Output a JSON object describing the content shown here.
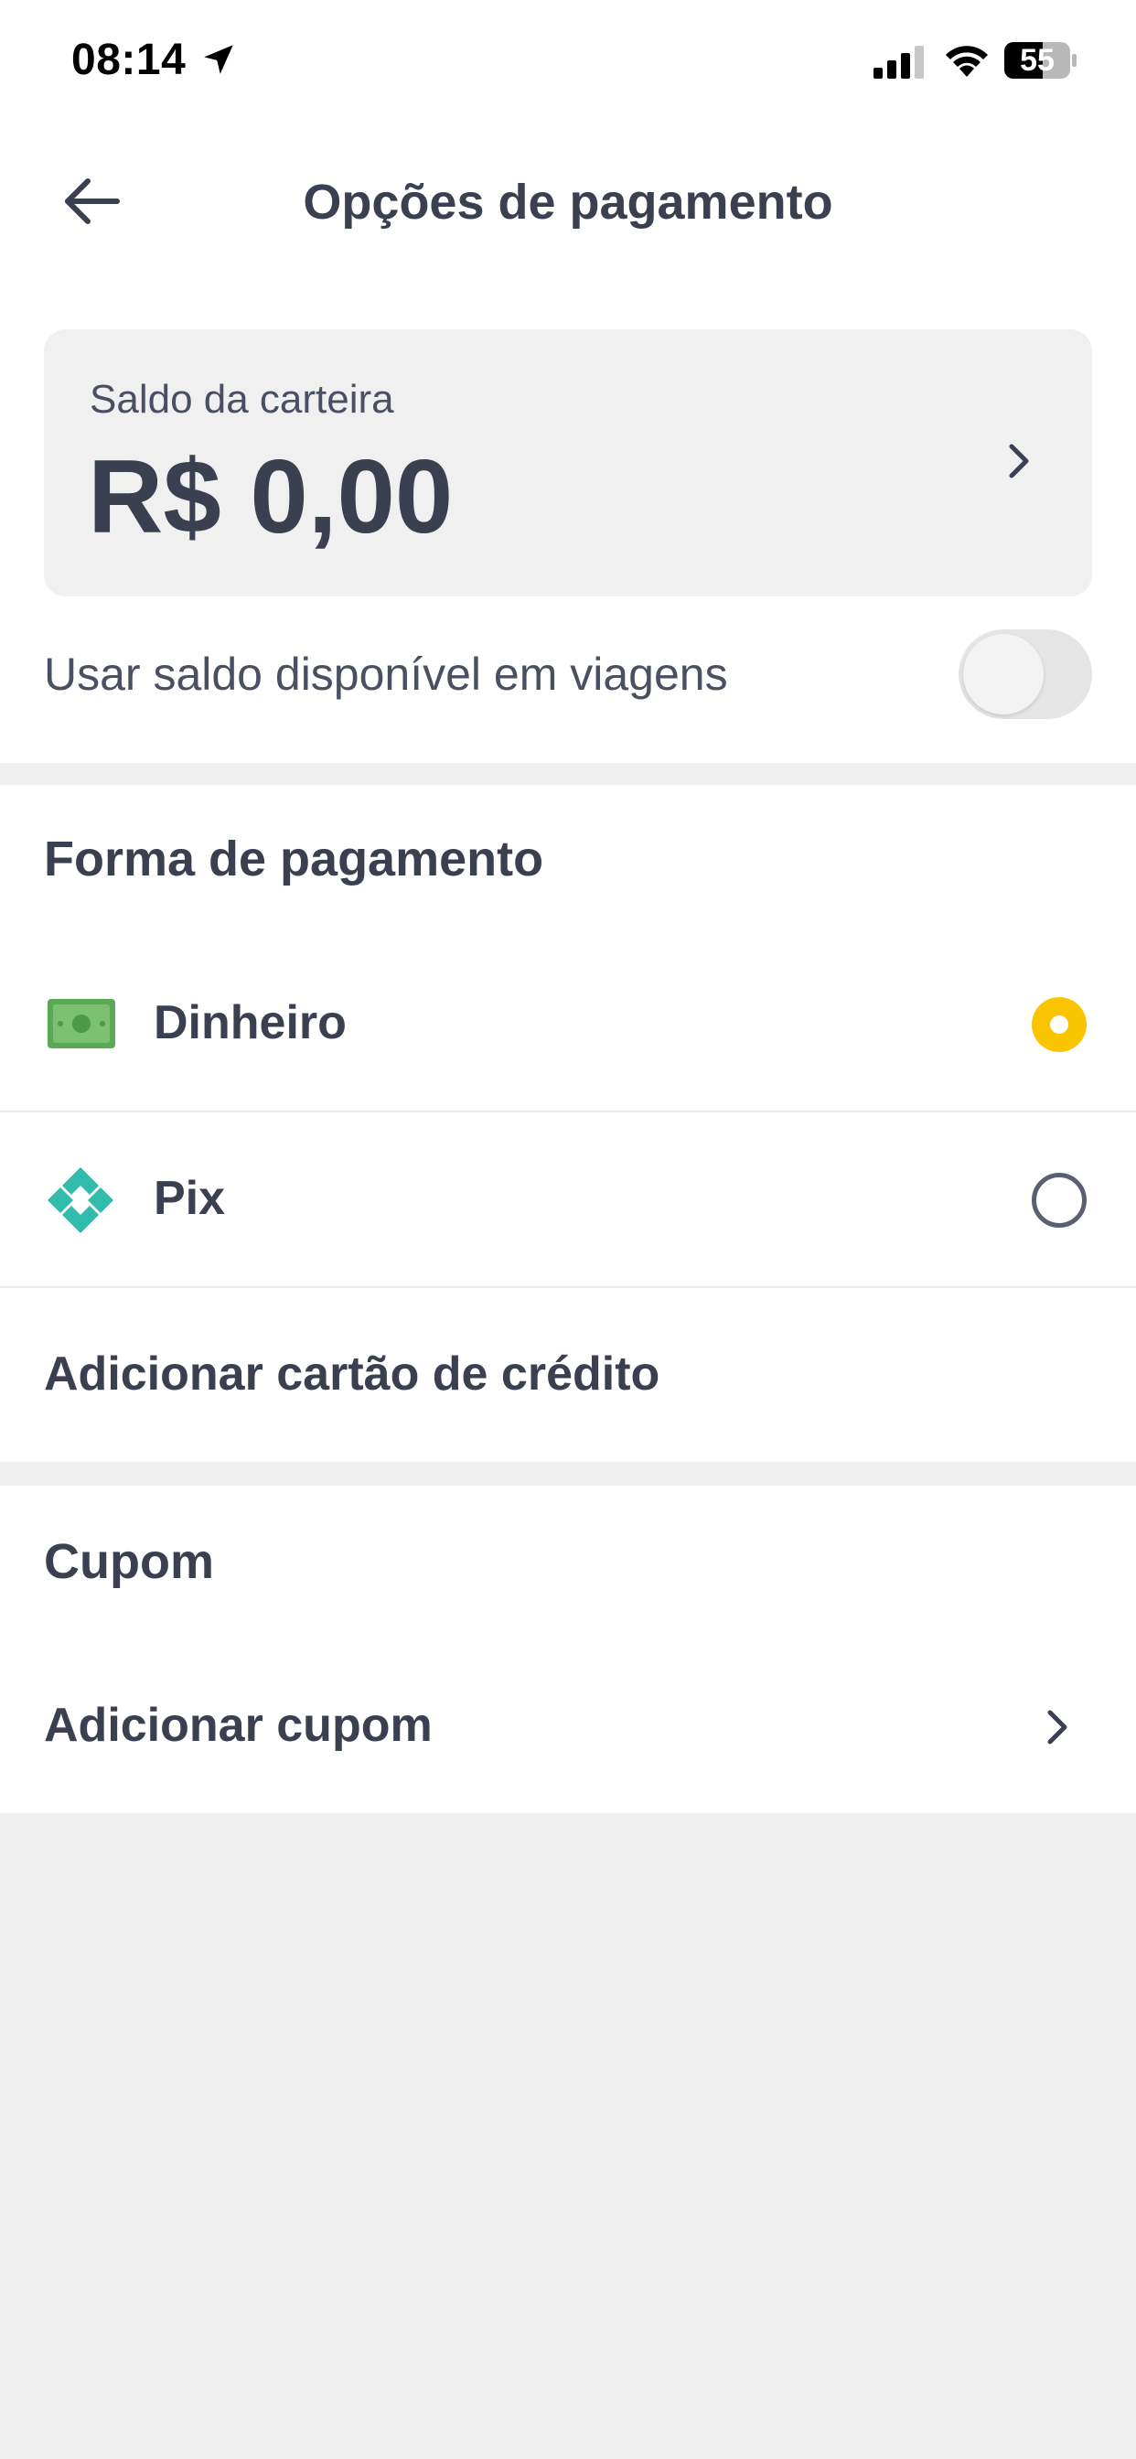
{
  "status_bar": {
    "time": "08:14",
    "battery": "55"
  },
  "header": {
    "title": "Opções de pagamento"
  },
  "wallet": {
    "label": "Saldo da carteira",
    "amount": "R$ 0,00"
  },
  "balance_toggle": {
    "label": "Usar saldo disponível em viagens",
    "enabled": false
  },
  "payment": {
    "section_title": "Forma de pagamento",
    "options": [
      {
        "label": "Dinheiro",
        "icon": "cash-icon",
        "selected": true
      },
      {
        "label": "Pix",
        "icon": "pix-icon",
        "selected": false
      }
    ],
    "add_card_label": "Adicionar cartão de crédito"
  },
  "coupon": {
    "section_title": "Cupom",
    "add_label": "Adicionar cupom"
  },
  "colors": {
    "accent": "#fbc400",
    "text": "#3b4050",
    "background": "#efefef",
    "cash_green": "#5aaa55",
    "pix_teal": "#32bcad"
  }
}
